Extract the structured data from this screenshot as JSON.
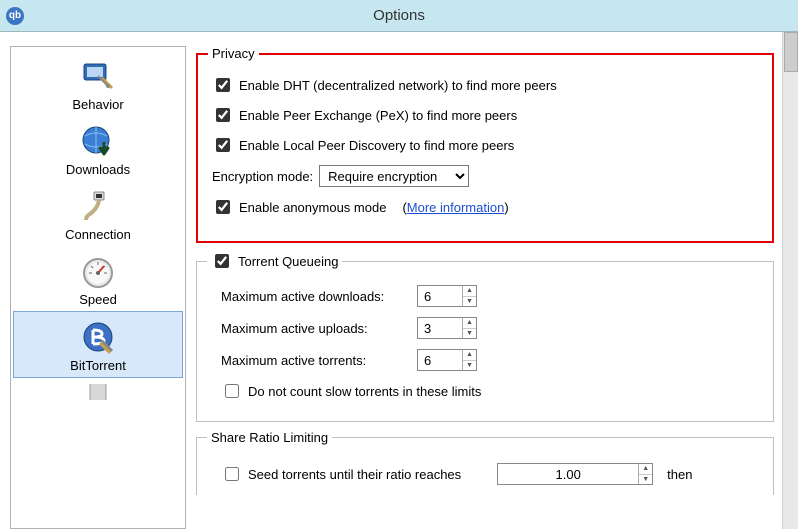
{
  "window": {
    "title": "Options",
    "app_icon_text": "qb"
  },
  "sidebar": {
    "items": [
      {
        "key": "behavior",
        "label": "Behavior"
      },
      {
        "key": "downloads",
        "label": "Downloads"
      },
      {
        "key": "connection",
        "label": "Connection"
      },
      {
        "key": "speed",
        "label": "Speed"
      },
      {
        "key": "bittorrent",
        "label": "BitTorrent",
        "selected": true
      }
    ]
  },
  "privacy": {
    "legend": "Privacy",
    "dht": {
      "label": "Enable DHT (decentralized network) to find more peers",
      "checked": true
    },
    "pex": {
      "label": "Enable Peer Exchange (PeX) to find more peers",
      "checked": true
    },
    "lpd": {
      "label": "Enable Local Peer Discovery to find more peers",
      "checked": true
    },
    "enc_label": "Encryption mode:",
    "enc_value": "Require encryption",
    "anon": {
      "label": "Enable anonymous mode",
      "checked": true
    },
    "more_info_open": "(",
    "more_info_text": "More information",
    "more_info_close": ")"
  },
  "queue": {
    "legend": "Torrent Queueing",
    "enabled": true,
    "max_dl_label": "Maximum active downloads:",
    "max_dl_value": "6",
    "max_ul_label": "Maximum active uploads:",
    "max_ul_value": "3",
    "max_at_label": "Maximum active torrents:",
    "max_at_value": "6",
    "slow": {
      "label": "Do not count slow torrents in these limits",
      "checked": false
    }
  },
  "share": {
    "legend": "Share Ratio Limiting",
    "seed": {
      "label": "Seed torrents until their ratio reaches",
      "checked": false
    },
    "ratio_value": "1.00",
    "then_label": "then"
  }
}
